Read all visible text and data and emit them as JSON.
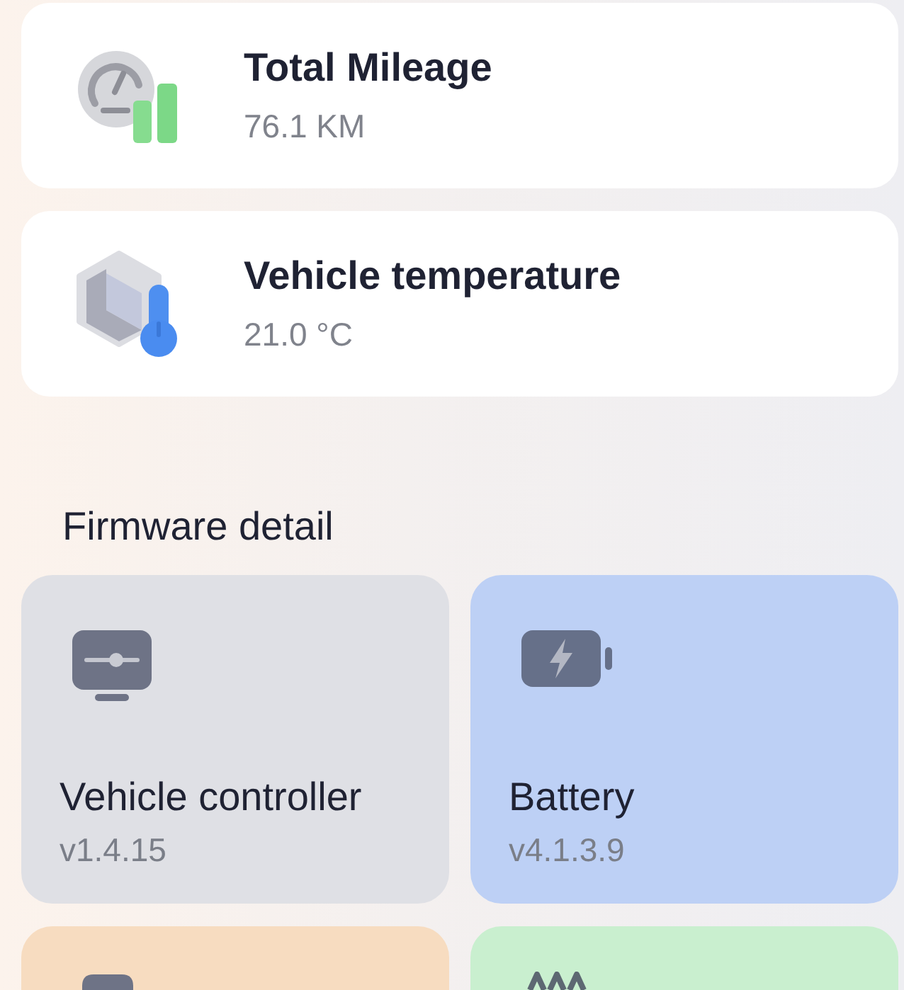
{
  "stats": [
    {
      "kind": "mileage",
      "title": "Total Mileage",
      "value": "76.1 KM"
    },
    {
      "kind": "temperature",
      "title": "Vehicle temperature",
      "value": "21.0 °C"
    }
  ],
  "firmware": {
    "heading": "Firmware detail",
    "items": [
      {
        "kind": "controller",
        "color": "#dfe0e5",
        "name": "Vehicle controller",
        "version": "v1.4.15"
      },
      {
        "kind": "battery",
        "color": "#bdd0f5",
        "name": "Battery",
        "version": "v4.1.3.9"
      },
      {
        "kind": "block",
        "color": "#f7dcc0"
      },
      {
        "kind": "peaks",
        "color": "#c9efcf"
      }
    ]
  }
}
